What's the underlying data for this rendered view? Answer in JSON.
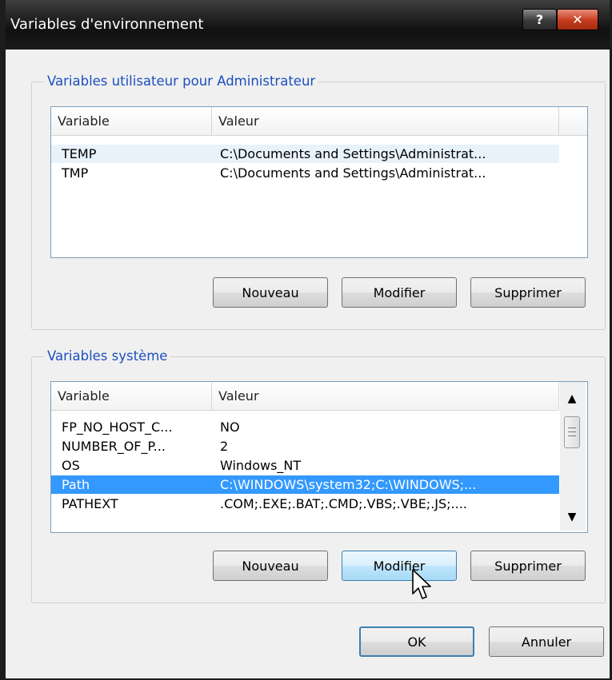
{
  "window": {
    "title": "Variables d'environnement",
    "help_label": "?",
    "close_label": "✕"
  },
  "user_vars": {
    "group_label": "Variables utilisateur pour Administrateur",
    "columns": [
      "Variable",
      "Valeur"
    ],
    "rows": [
      {
        "name": "TEMP",
        "value": "C:\\Documents and Settings\\Administrat..."
      },
      {
        "name": "TMP",
        "value": "C:\\Documents and Settings\\Administrat..."
      }
    ],
    "buttons": {
      "new": "Nouveau",
      "edit": "Modifier",
      "delete": "Supprimer"
    }
  },
  "system_vars": {
    "group_label": "Variables système",
    "columns": [
      "Variable",
      "Valeur"
    ],
    "rows": [
      {
        "name": "FP_NO_HOST_C...",
        "value": "NO"
      },
      {
        "name": "NUMBER_OF_P...",
        "value": "2"
      },
      {
        "name": "OS",
        "value": "Windows_NT"
      },
      {
        "name": "Path",
        "value": "C:\\WINDOWS\\system32;C:\\WINDOWS;..."
      },
      {
        "name": "PATHEXT",
        "value": ".COM;.EXE;.BAT;.CMD;.VBS;.VBE;.JS;...."
      }
    ],
    "selected_row": "Path",
    "buttons": {
      "new": "Nouveau",
      "edit": "Modifier",
      "delete": "Supprimer"
    }
  },
  "footer": {
    "ok": "OK",
    "cancel": "Annuler"
  },
  "icons": {
    "scroll_up": "up-arrow",
    "scroll_down": "down-arrow",
    "cursor": "arrow-pointer"
  },
  "colors": {
    "selection": "#3399ff",
    "group_label": "#1c4fbf",
    "titlebar": "#1a1a1a"
  }
}
